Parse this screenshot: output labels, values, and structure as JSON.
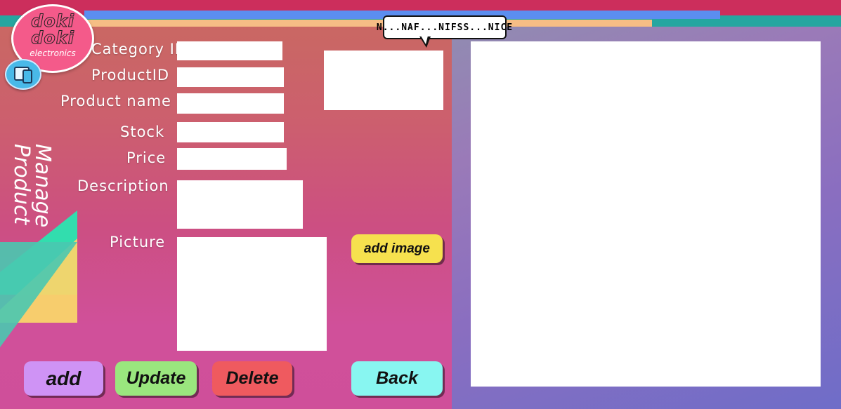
{
  "logo": {
    "line1": "doki",
    "line2": "doki",
    "subtitle": "electronics"
  },
  "page_title": {
    "line1": "Manage",
    "line2": "Product"
  },
  "tooltip": {
    "text": "N...NAF...NIFSS...NICE"
  },
  "form": {
    "category_id": {
      "label": "Category ID",
      "value": ""
    },
    "product_id": {
      "label": "ProductID",
      "value": ""
    },
    "product_name": {
      "label": "Product name",
      "value": ""
    },
    "stock": {
      "label": "Stock",
      "value": ""
    },
    "price": {
      "label": "Price",
      "value": ""
    },
    "description": {
      "label": "Description",
      "value": ""
    },
    "picture": {
      "label": "Picture"
    }
  },
  "buttons": {
    "add": "add",
    "update": "Update",
    "delete": "Delete",
    "back": "Back",
    "add_image": "add image"
  },
  "colors": {
    "accent_pink": "#cc2e5c",
    "accent_teal": "#25a6a0",
    "accent_blue": "#5b8ef0",
    "accent_peach": "#f6bd85",
    "btn_add": "#cf93f5",
    "btn_update": "#9ae67e",
    "btn_delete": "#ef5a5f",
    "btn_back": "#88f6f1",
    "btn_add_image": "#f6e14e"
  }
}
